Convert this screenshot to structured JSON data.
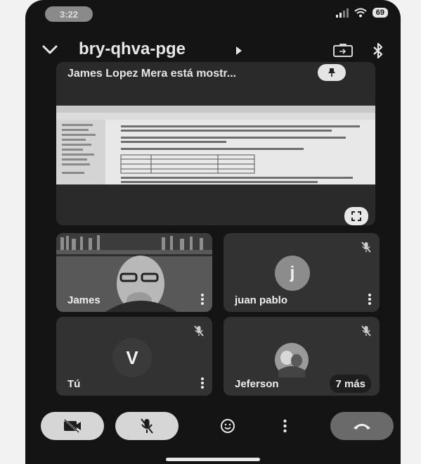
{
  "status": {
    "time": "3:22",
    "battery": "69"
  },
  "meeting": {
    "code": "bry-qhva-pge"
  },
  "presentation": {
    "label": "James Lopez Mera está mostr..."
  },
  "participants": [
    {
      "name": "James",
      "muted": false
    },
    {
      "name": "juan pablo",
      "initial": "j",
      "muted": true
    },
    {
      "name": "Tú",
      "initial": "V",
      "muted": true
    },
    {
      "name": "Jeferson",
      "muted": true
    }
  ],
  "others": {
    "label": "7 más"
  },
  "icons": {
    "back": "chevron-down-icon",
    "details": "triangle-right-icon",
    "camera_switch": "camera-switch-icon",
    "bluetooth": "bluetooth-icon",
    "pin": "pin-icon",
    "fullscreen": "fullscreen-icon",
    "more": "more-vert-icon",
    "mic_off": "mic-off-icon",
    "camera_off": "camera-off-icon",
    "reactions": "emoji-icon",
    "end_call": "end-call-icon"
  },
  "colors": {
    "background": "#141414",
    "tile": "#323232",
    "button_light": "#d6d6d6",
    "end_call": "#6a6a6a",
    "avatar_j": "#8c8c8c"
  }
}
